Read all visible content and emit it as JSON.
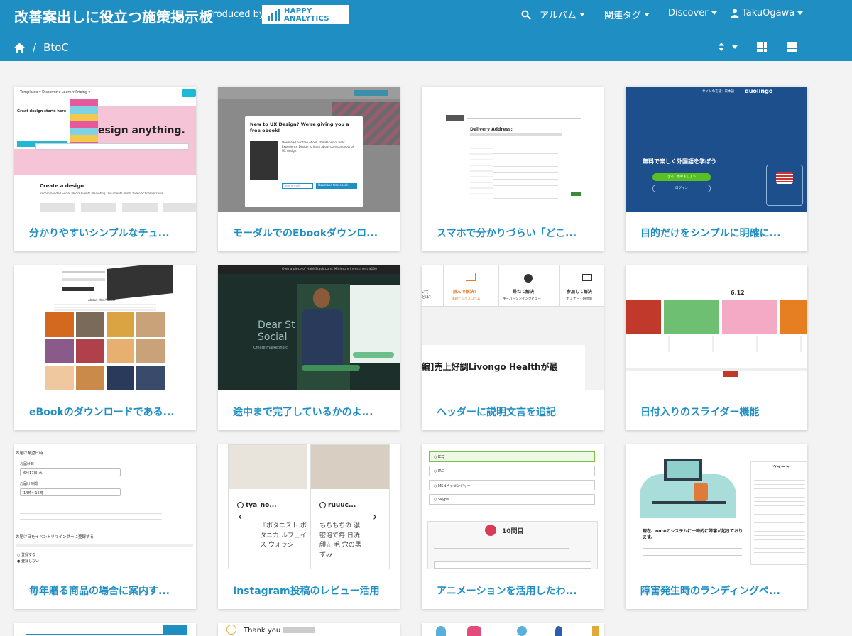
{
  "header": {
    "site_title": "改善案出しに役立つ施策掲示板",
    "produced_by": "Produced by",
    "logo_text": "HAPPY ANALYTICS",
    "nav": {
      "album": "アルバム",
      "tags": "関連タグ",
      "discover": "Discover",
      "user": "TakuOgawa"
    }
  },
  "breadcrumb": {
    "current": "BtoC"
  },
  "colors": {
    "primary": "#1f8ec3",
    "background": "#f3f3f3"
  },
  "cards": [
    {
      "title": "分かりやすいシンプルなチュ...",
      "thumb_text": "esign anything."
    },
    {
      "title": "モーダルでのEbookダウンロ...",
      "thumb_text": "New to UX Design? We're giving you a free ebook!"
    },
    {
      "title": "スマホで分かりづらい「どこ...",
      "thumb_text": "Delivery Address:"
    },
    {
      "title": "目的だけをシンプルに明確に...",
      "thumb_text": "無料で楽しく外国語を学ぼう"
    },
    {
      "title": "eBookのダウンロードである...",
      "thumb_text": "About the Author"
    },
    {
      "title": "途中まで完了しているかのよ...",
      "thumb_text": "Dear St Social"
    },
    {
      "title": "ヘッダーに説明文言を追記",
      "thumb_text": "編]売上好調Livongo Healthが最"
    },
    {
      "title": "日付入りのスライダー機能",
      "thumb_text": "6.12"
    },
    {
      "title": "毎年贈る商品の場合に案内す...",
      "thumb_text": "お届け希望日時"
    },
    {
      "title": "Instagram投稿のレビュー活用",
      "thumb_text": "tya_no..."
    },
    {
      "title": "アニメーションを活用したわ...",
      "thumb_text": "10問目"
    },
    {
      "title": "障害発生時のランディングペ...",
      "thumb_text": "現在、noteのシステムに一時的に障害が起きております。"
    }
  ],
  "thumbs": {
    "t1": {
      "nav": "Templates ▾   Discover ▾   Learn ▾   Pricing ▾",
      "headline": "Great design starts here",
      "create": "Create a design",
      "tabs": "Recommended   Social Media   Events   Marketing   Documents   Prints   Video   School   Personal"
    },
    "t2": {
      "body": "Download our free ebook The Basics of User Experience Design to learn about core concepts of UX design.",
      "button": "Download free ebook",
      "placeholder": "Your e-mail"
    },
    "t4": {
      "brand": "duolingo",
      "sub": "サイトの言語：日本語",
      "btn1": "さあ、始めましょう",
      "btn2": "ログイン"
    },
    "t6": {
      "top": "Own a piece of HabitStack.com: Minimum investment $100",
      "sub": "Create marketing c"
    },
    "t7": {
      "n1": "読んで解決！",
      "n1b": "課題ビジネスコラム",
      "n2": "尋ねて解決！",
      "n2b": "キーパーソンインタビュー",
      "n3": "参加して解決",
      "n3b": "セミナー・研修情"
    },
    "t9": {
      "l1": "お届け日",
      "l1v": "6月17日(水)",
      "l2": "お届け時間",
      "l2v": "14時〜16時",
      "reminder": "お届け日をイベントリマインダーに登録する",
      "opt1": "登録する",
      "opt2": "登録しない"
    },
    "t10": {
      "u1": "tya_no...",
      "u2": "ruuuc...",
      "q1": "『ボタニスト ボタニカ ルフェイス ウォッシ",
      "q2": "もちもちの 濃密泡で毎 日洗顔☆ 毛 穴の黒ずみ"
    },
    "t11": {
      "o1": "ICQ",
      "o2": "IRC",
      "o3": "MSNメッセンジャー",
      "o4": "Skype"
    },
    "t12": {
      "tweet": "ツイート",
      "note": "現在、noteのシステムに一時的に障害が起きております。"
    }
  },
  "bottom": {
    "thank_you": "Thank you"
  }
}
